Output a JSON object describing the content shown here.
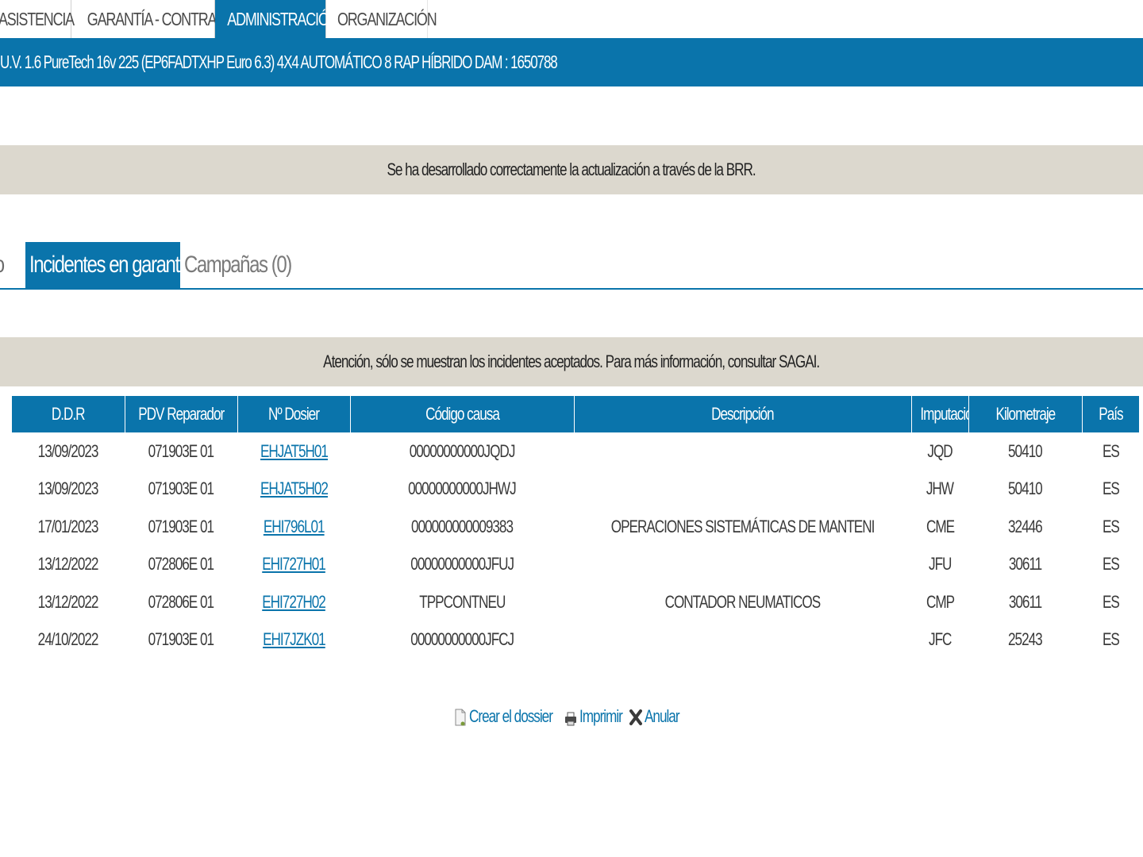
{
  "top_nav": {
    "tabs": [
      {
        "label": "ASISTENCIA",
        "active": false
      },
      {
        "label": "GARANTÍA - CONTRATOS",
        "active": false
      },
      {
        "label": "ADMINISTRACIÓN",
        "active": true
      },
      {
        "label": "ORGANIZACIÓN",
        "active": false
      }
    ]
  },
  "vehicle": {
    "description": "U.V. 1.6 PureTech 16v 225 (EP6FADTXHP Euro 6.3) 4X4 AUTOMÁTICO 8 RAP HÍBRIDO  DAM : 1650788"
  },
  "messages": {
    "success": "Se ha desarrollado correctamente la actualización a través de la BRR.",
    "attention": "Atención, sólo se muestran los incidentes aceptados. Para más información, consultar SAGAI."
  },
  "sub_tabs": {
    "previous_partial": "ulo",
    "active": "Incidentes en garantía",
    "campaigns": "Campañas (0)"
  },
  "table": {
    "headers": [
      "D.D.R",
      "PDV Reparador",
      "Nº Dosier",
      "Código causa",
      "Descripción",
      "Imputación",
      "Kilometraje",
      "País"
    ],
    "rows": [
      {
        "ddr": "13/09/2023",
        "pdv": "071903E 01",
        "dosier": "EHJAT5H01",
        "codigo": "00000000000JQDJ",
        "descripcion": "",
        "imputacion": "JQD",
        "km": "50410",
        "pais": "ES"
      },
      {
        "ddr": "13/09/2023",
        "pdv": "071903E 01",
        "dosier": "EHJAT5H02",
        "codigo": "00000000000JHWJ",
        "descripcion": "",
        "imputacion": "JHW",
        "km": "50410",
        "pais": "ES"
      },
      {
        "ddr": "17/01/2023",
        "pdv": "071903E 01",
        "dosier": "EHI796L01",
        "codigo": "000000000009383",
        "descripcion": "OPERACIONES SISTEMÁTICAS DE MANTENI",
        "imputacion": "CME",
        "km": "32446",
        "pais": "ES"
      },
      {
        "ddr": "13/12/2022",
        "pdv": "072806E 01",
        "dosier": "EHI727H01",
        "codigo": "00000000000JFUJ",
        "descripcion": "",
        "imputacion": "JFU",
        "km": "30611",
        "pais": "ES"
      },
      {
        "ddr": "13/12/2022",
        "pdv": "072806E 01",
        "dosier": "EHI727H02",
        "codigo": "TPPCONTNEU",
        "descripcion": "CONTADOR NEUMATICOS",
        "imputacion": "CMP",
        "km": "30611",
        "pais": "ES"
      },
      {
        "ddr": "24/10/2022",
        "pdv": "071903E 01",
        "dosier": "EHI7JZK01",
        "codigo": "00000000000JFCJ",
        "descripcion": "",
        "imputacion": "JFC",
        "km": "25243",
        "pais": "ES"
      }
    ]
  },
  "actions": {
    "create": {
      "label": "Crear el dossier",
      "icon": "new-document-icon"
    },
    "print": {
      "label": "Imprimir",
      "icon": "printer-icon"
    },
    "cancel": {
      "label": "Anular",
      "icon": "close-icon"
    }
  },
  "colors": {
    "brand_blue": "#0a74ab",
    "message_bg": "#dcd8ce",
    "link": "#0a74ab"
  }
}
